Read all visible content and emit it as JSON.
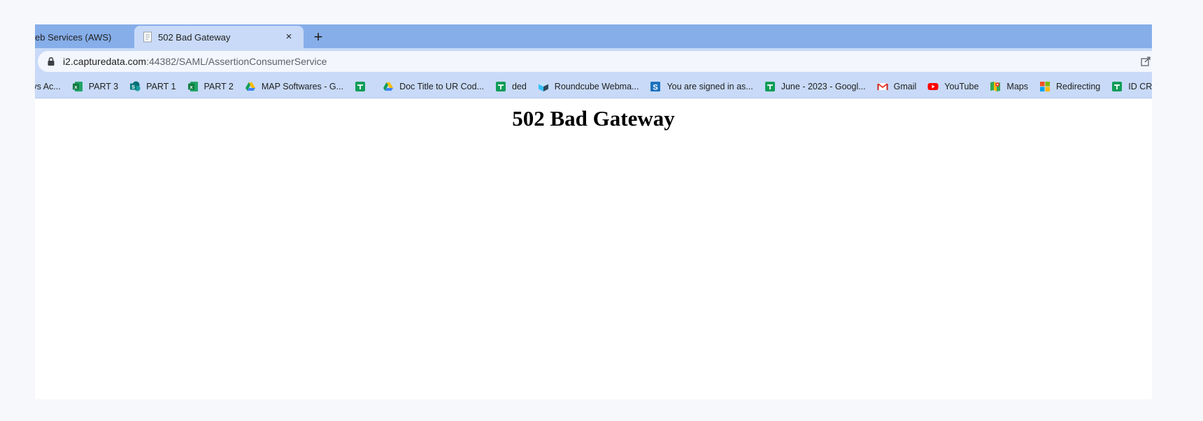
{
  "tabs": [
    {
      "label": "eb Services (AWS)",
      "active": false,
      "close_label": "×"
    },
    {
      "label": "502 Bad Gateway",
      "active": true,
      "close_label": "×"
    }
  ],
  "new_tab_label": "+",
  "address_bar": {
    "host": "i2.capturedata.com",
    "rest": ":44382/SAML/AssertionConsumerService"
  },
  "bookmarks": [
    {
      "label": "n vs Ac...",
      "icon": "none"
    },
    {
      "label": "PART 3",
      "icon": "excel-icon"
    },
    {
      "label": "PART 1",
      "icon": "sharepoint-icon"
    },
    {
      "label": "PART 2",
      "icon": "excel-icon"
    },
    {
      "label": "MAP Softwares - G...",
      "icon": "google-drive-icon"
    },
    {
      "label": "",
      "icon": "google-sheets-icon"
    },
    {
      "label": "Doc Title to UR Cod...",
      "icon": "google-drive-icon"
    },
    {
      "label": "ded",
      "icon": "google-sheets-icon"
    },
    {
      "label": "Roundcube Webma...",
      "icon": "roundcube-icon"
    },
    {
      "label": "You are signed in as...",
      "icon": "sway-icon"
    },
    {
      "label": "June - 2023 - Googl...",
      "icon": "google-sheets-icon"
    },
    {
      "label": "Gmail",
      "icon": "gmail-icon"
    },
    {
      "label": "YouTube",
      "icon": "youtube-icon"
    },
    {
      "label": "Maps",
      "icon": "google-maps-icon"
    },
    {
      "label": "Redirecting",
      "icon": "microsoft-icon"
    },
    {
      "label": "ID CREATION - Dy",
      "icon": "google-sheets-icon"
    }
  ],
  "page": {
    "heading": "502 Bad Gateway"
  },
  "colors": {
    "tabstrip": "#86aee9",
    "toolbar": "#c8daf7",
    "omnibox": "#f3f6fc",
    "desktop": "#f7f8fc"
  }
}
